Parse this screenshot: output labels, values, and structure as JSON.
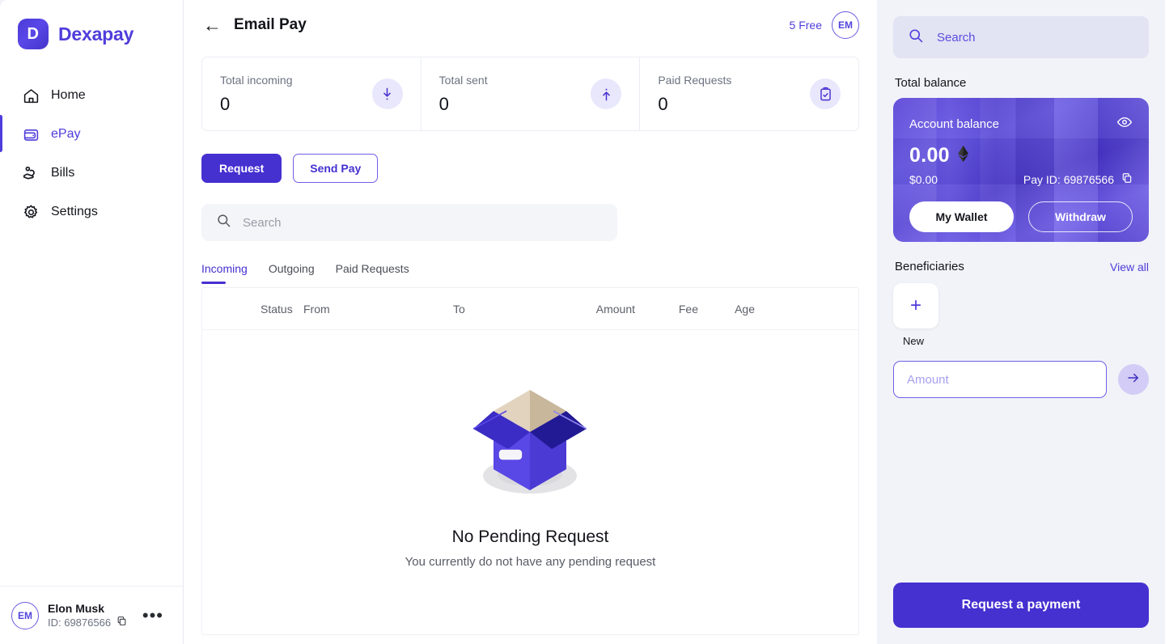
{
  "brand": {
    "logo_letter": "D",
    "name": "Dexapay"
  },
  "sidebar": {
    "items": [
      {
        "label": "Home",
        "icon": "home-icon"
      },
      {
        "label": "ePay",
        "icon": "wallet-icon"
      },
      {
        "label": "Bills",
        "icon": "bills-icon"
      },
      {
        "label": "Settings",
        "icon": "gear-icon"
      }
    ],
    "user": {
      "initials": "EM",
      "name": "Elon Musk",
      "id": "ID: 69876566"
    }
  },
  "header": {
    "title": "Email Pay",
    "free_label": "5 Free",
    "avatar_initials": "EM"
  },
  "stats": [
    {
      "label": "Total incoming",
      "value": "0",
      "icon": "arrow-down-icon"
    },
    {
      "label": "Total sent",
      "value": "0",
      "icon": "arrow-up-icon"
    },
    {
      "label": "Paid Requests",
      "value": "0",
      "icon": "clipboard-check-icon"
    }
  ],
  "actions": {
    "request": "Request",
    "send_pay": "Send Pay"
  },
  "search": {
    "placeholder": "Search"
  },
  "tabs": [
    {
      "label": "Incoming",
      "active": true
    },
    {
      "label": "Outgoing",
      "active": false
    },
    {
      "label": "Paid Requests",
      "active": false
    }
  ],
  "table": {
    "columns": [
      "Status",
      "From",
      "To",
      "Amount",
      "Fee",
      "Age"
    ],
    "rows": []
  },
  "empty_state": {
    "title": "No Pending Request",
    "subtitle": "You currently do not have any pending request",
    "illustration": "open-box-illustration"
  },
  "right_panel": {
    "search_placeholder": "Search",
    "total_balance_label": "Total balance",
    "card": {
      "label": "Account balance",
      "amount": "0.00",
      "currency_icon": "ethereum-icon",
      "usd": "$0.00",
      "pay_id": "Pay ID: 69876566",
      "wallet_button": "My Wallet",
      "withdraw_button": "Withdraw"
    },
    "beneficiaries": {
      "title": "Beneficiaries",
      "view_all": "View all",
      "new_label": "New",
      "new_icon": "plus-icon"
    },
    "amount_placeholder": "Amount",
    "request_payment_button": "Request a payment"
  },
  "colors": {
    "accent": "#4530d0",
    "accent_light": "#4f3ddb",
    "page_bg": "#f1f3f8",
    "panel_bg": "#e2e3f3"
  }
}
